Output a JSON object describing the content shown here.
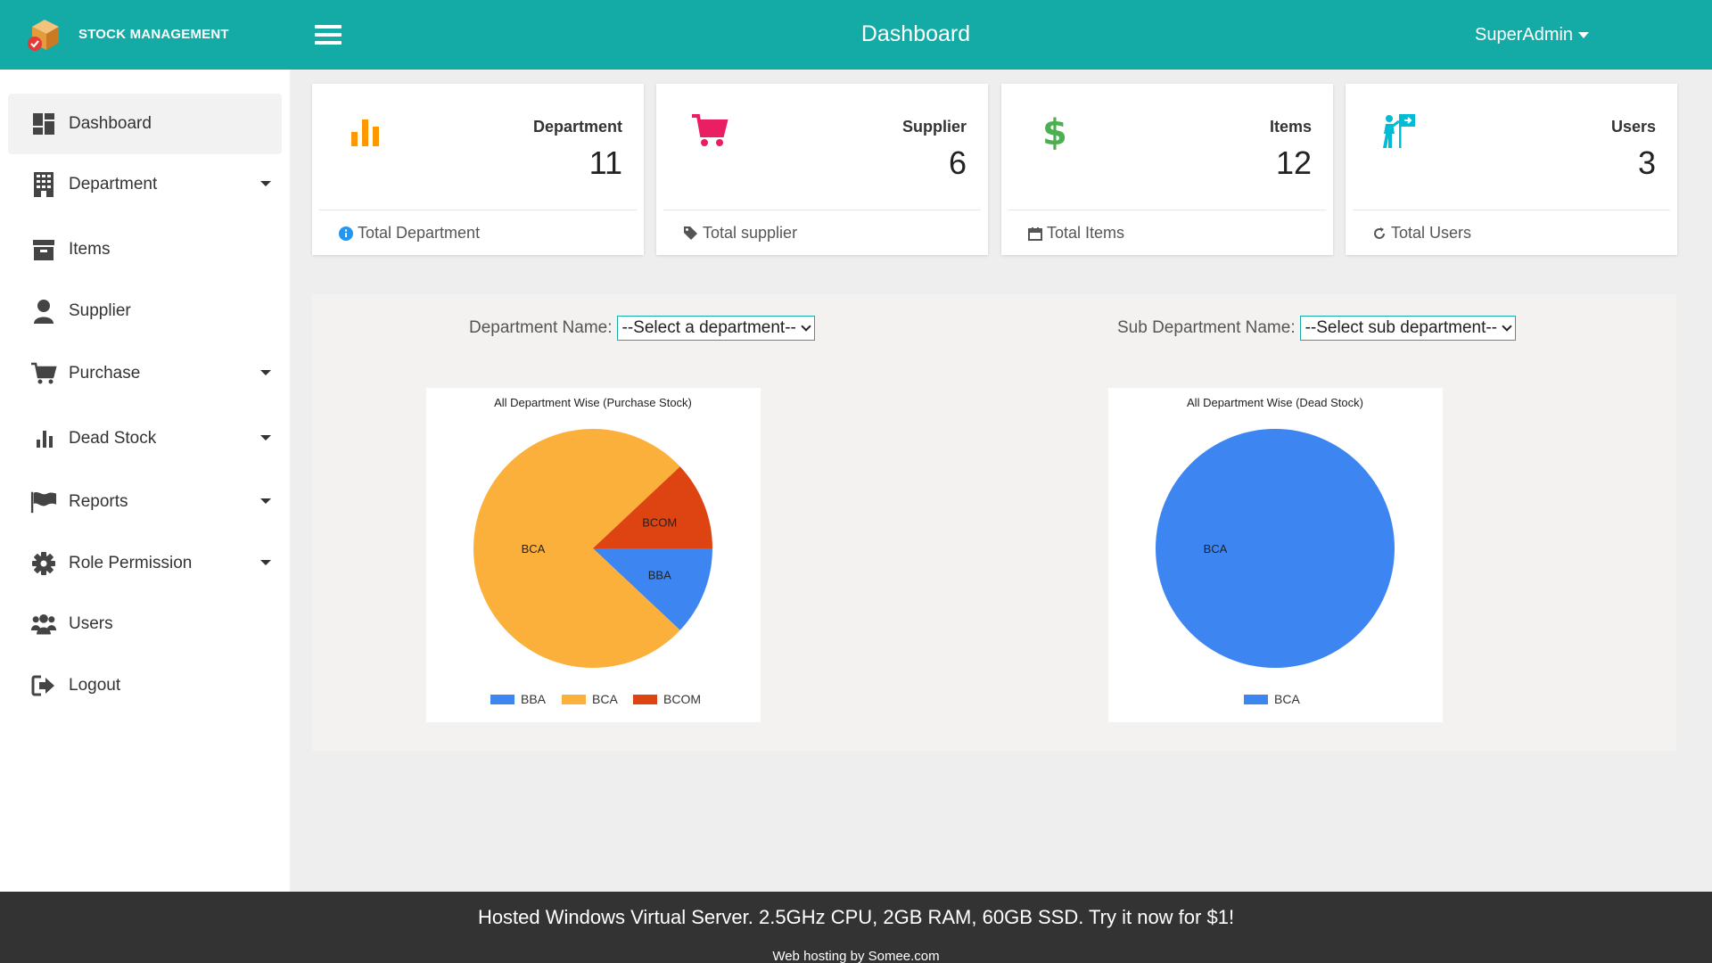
{
  "header": {
    "brand": "STOCK MANAGEMENT",
    "title": "Dashboard",
    "user": "SuperAdmin"
  },
  "sidebar": {
    "items": [
      {
        "label": "Dashboard",
        "icon": "dashboard-icon",
        "active": true,
        "dropdown": false
      },
      {
        "label": "Department",
        "icon": "building-icon",
        "dropdown": true
      },
      {
        "label": "Items",
        "icon": "archive-icon",
        "dropdown": false
      },
      {
        "label": "Supplier",
        "icon": "user-icon",
        "dropdown": false
      },
      {
        "label": "Purchase",
        "icon": "cart-icon",
        "dropdown": true
      },
      {
        "label": "Dead Stock",
        "icon": "bar-chart-icon",
        "dropdown": true
      },
      {
        "label": "Reports",
        "icon": "flag-icon",
        "dropdown": true
      },
      {
        "label": "Role Permission",
        "icon": "gear-icon",
        "dropdown": true
      },
      {
        "label": "Users",
        "icon": "users-icon",
        "dropdown": false
      },
      {
        "label": "Logout",
        "icon": "logout-icon",
        "dropdown": false
      }
    ]
  },
  "cards": [
    {
      "label": "Department",
      "value": "11",
      "footer": "Total Department",
      "icon": "bar-chart-icon",
      "color": "#ff9800"
    },
    {
      "label": "Supplier",
      "value": "6",
      "footer": "Total supplier",
      "icon": "cart-icon",
      "color": "#e91e63"
    },
    {
      "label": "Items",
      "value": "12",
      "footer": "Total Items",
      "icon": "dollar-icon",
      "color": "#4caf50"
    },
    {
      "label": "Users",
      "value": "3",
      "footer": "Total Users",
      "icon": "person-sign-icon",
      "color": "#00bcd4"
    }
  ],
  "filters": {
    "department_label": "Department Name:",
    "department_value": "--Select a department--",
    "subdepartment_label": "Sub Department Name:",
    "subdepartment_value": "--Select sub department--"
  },
  "chart_data": [
    {
      "type": "pie",
      "title": "All Department Wise (Purchase Stock)",
      "categories": [
        "BBA",
        "BCA",
        "BCOM"
      ],
      "values": [
        12,
        76,
        12
      ],
      "colors": [
        "#3d85f0",
        "#fbb03b",
        "#dd4411"
      ],
      "legend": "bottom"
    },
    {
      "type": "pie",
      "title": "All Department Wise (Dead Stock)",
      "categories": [
        "BCA"
      ],
      "values": [
        100
      ],
      "colors": [
        "#3d85f0"
      ],
      "legend": "bottom"
    }
  ],
  "ad": {
    "main": "Hosted Windows Virtual Server. 2.5GHz CPU, 2GB RAM, 60GB SSD. Try it now for $1!",
    "sub": "Web hosting by Somee.com"
  },
  "colors": {
    "primary": "#14aaa5",
    "sidebar_bg": "#ffffff",
    "content_bg": "#eeeeee",
    "ad_bg": "#333333"
  }
}
